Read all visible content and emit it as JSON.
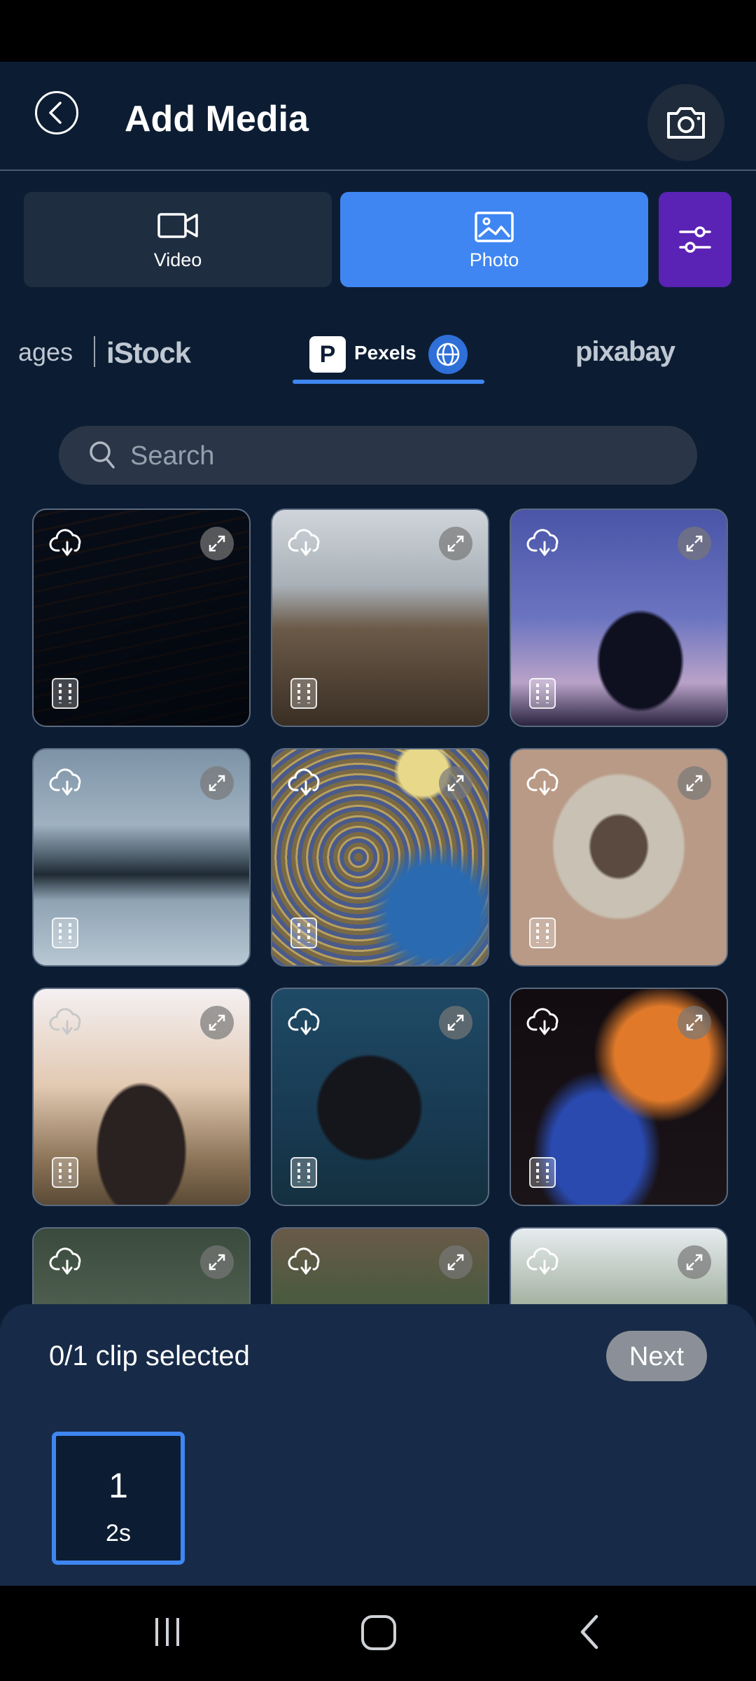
{
  "header": {
    "title": "Add Media"
  },
  "media_tabs": [
    {
      "label": "Video",
      "icon": "video-camera-icon",
      "active": false
    },
    {
      "label": "Photo",
      "icon": "image-icon",
      "active": true
    }
  ],
  "sources": {
    "images_partial": "ages",
    "istock": "iStock",
    "pexels": "Pexels",
    "pixabay": "pixabay",
    "active": "Pexels"
  },
  "search": {
    "placeholder": "Search",
    "value": ""
  },
  "bottom": {
    "selection_text": "0/1 clip selected",
    "next_label": "Next"
  },
  "clip": {
    "number": "1",
    "duration": "2s"
  },
  "colors": {
    "accent": "#3f86f2",
    "filter": "#5a22b5",
    "background": "#0c1d33"
  }
}
